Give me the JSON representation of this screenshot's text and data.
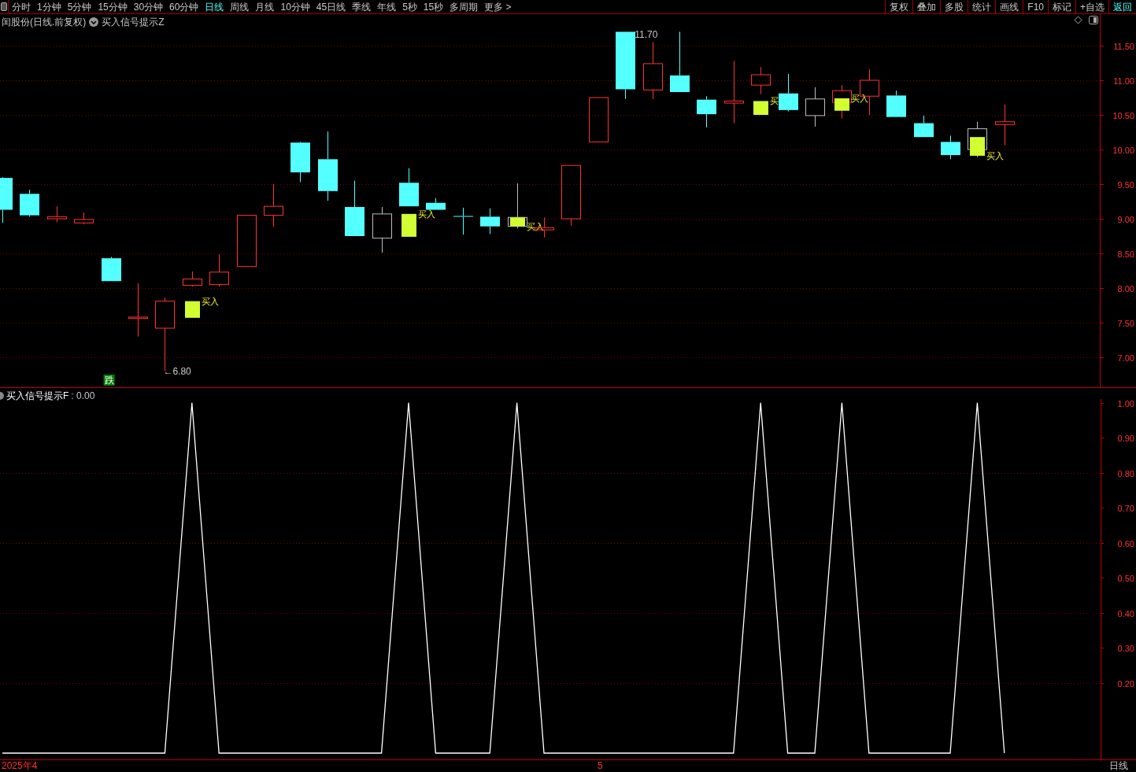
{
  "periods": [
    {
      "label": "分时",
      "selected": false
    },
    {
      "label": "1分钟",
      "selected": false
    },
    {
      "label": "5分钟",
      "selected": false
    },
    {
      "label": "15分钟",
      "selected": false
    },
    {
      "label": "30分钟",
      "selected": false
    },
    {
      "label": "60分钟",
      "selected": false
    },
    {
      "label": "日线",
      "selected": true
    },
    {
      "label": "周线",
      "selected": false
    },
    {
      "label": "月线",
      "selected": false
    },
    {
      "label": "10分钟",
      "selected": false
    },
    {
      "label": "45日线",
      "selected": false
    },
    {
      "label": "季线",
      "selected": false
    },
    {
      "label": "年线",
      "selected": false
    },
    {
      "label": "5秒",
      "selected": false
    },
    {
      "label": "15秒",
      "selected": false
    },
    {
      "label": "多周期",
      "selected": false
    },
    {
      "label": "更多 >",
      "selected": false
    }
  ],
  "tools": [
    {
      "label": "复权",
      "accent": false
    },
    {
      "label": "叠加",
      "accent": false
    },
    {
      "label": "多股",
      "accent": false
    },
    {
      "label": "统计",
      "accent": false
    },
    {
      "label": "画线",
      "accent": false
    },
    {
      "label": "F10",
      "accent": false
    },
    {
      "label": "标记",
      "accent": false
    },
    {
      "label": "+自选",
      "accent": false
    },
    {
      "label": "返回",
      "accent": true
    }
  ],
  "main_panel": {
    "title": "闰股份(日线.前复权)",
    "indicator": "买入信号提示Z",
    "axis_labels": [
      "11.50",
      "11.00",
      "10.50",
      "10.00",
      "9.50",
      "9.00",
      "8.50",
      "8.00",
      "7.50",
      "7.00"
    ],
    "signal_labels": [
      "买入",
      "买入",
      "买入",
      "买",
      "买入",
      "买入"
    ],
    "high_label": "11.70",
    "low_label": "←6.80",
    "badge": "跌"
  },
  "signal_panel": {
    "reading": ": 0.00",
    "chart_data": {
      "type": "line",
      "grid": true,
      "ylim": [
        -0.018,
        1.011
      ],
      "categories": [
        null,
        null,
        null,
        null,
        null,
        null,
        null,
        null,
        null,
        null,
        null,
        null,
        null,
        null,
        null,
        null,
        null,
        null,
        null,
        null,
        null,
        null,
        null,
        null,
        null,
        null,
        null,
        null,
        null,
        null,
        null,
        null,
        null,
        null,
        null,
        null,
        null,
        null
      ],
      "yticks": [
        {
          "value": 1,
          "label": "1.00"
        },
        {
          "value": 0.9,
          "label": "0.90"
        },
        {
          "value": 0.8,
          "label": "0.80"
        },
        {
          "value": 0.7,
          "label": "0.70"
        },
        {
          "value": 0.6,
          "label": "0.60"
        },
        {
          "value": 0.5,
          "label": "0.50"
        },
        {
          "value": 0.4,
          "label": "0.40"
        },
        {
          "value": 0.3,
          "label": "0.30"
        },
        {
          "value": 0.2,
          "label": "0.20"
        }
      ],
      "series": [
        {
          "name": "买入信号提示F",
          "color": "#ffffff",
          "values": [
            0,
            0,
            0,
            0,
            0,
            0,
            0,
            1,
            0,
            0,
            0,
            0,
            0,
            0,
            0,
            1,
            0,
            0,
            0,
            1,
            0,
            0,
            0,
            0,
            0,
            0,
            0,
            0,
            1,
            0,
            0,
            1,
            0,
            0,
            0,
            0,
            1,
            0
          ]
        }
      ]
    }
  },
  "time_axis": [
    "2025年4",
    "5"
  ],
  "period_label": "日线"
}
